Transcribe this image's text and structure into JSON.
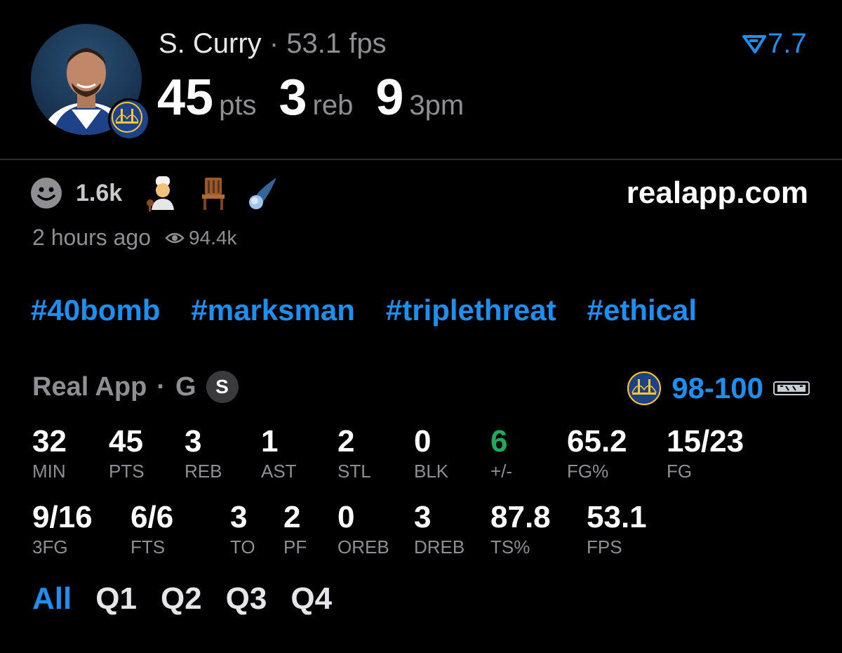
{
  "header": {
    "player_name": "S. Curry",
    "separator": "·",
    "fps_text": "53.1 fps",
    "rating": "7.7",
    "headline": [
      {
        "value": "45",
        "unit": "pts"
      },
      {
        "value": "3",
        "unit": "reb"
      },
      {
        "value": "9",
        "unit": "3pm"
      }
    ]
  },
  "reactions": {
    "count": "1.6k",
    "emojis": [
      "chef-emoji",
      "chair-emoji",
      "comet-emoji"
    ]
  },
  "site": "realapp.com",
  "meta": {
    "time": "2 hours ago",
    "views": "94.4k"
  },
  "tags": [
    "#40bomb",
    "#marksman",
    "#triplethreat",
    "#ethical"
  ],
  "game": {
    "source": "Real App",
    "separator": "·",
    "position": "G",
    "badge": "S",
    "score": "98-100"
  },
  "stats_row1": [
    {
      "value": "32",
      "label": "MIN"
    },
    {
      "value": "45",
      "label": "PTS"
    },
    {
      "value": "3",
      "label": "REB"
    },
    {
      "value": "1",
      "label": "AST"
    },
    {
      "value": "2",
      "label": "STL"
    },
    {
      "value": "0",
      "label": "BLK"
    },
    {
      "value": "6",
      "label": "+/-"
    },
    {
      "value": "65.2",
      "label": "FG%"
    },
    {
      "value": "15/23",
      "label": "FG"
    }
  ],
  "stats_row2": [
    {
      "value": "9/16",
      "label": "3FG"
    },
    {
      "value": "6/6",
      "label": "FTS"
    },
    {
      "value": "3",
      "label": "TO"
    },
    {
      "value": "2",
      "label": "PF"
    },
    {
      "value": "0",
      "label": "OREB"
    },
    {
      "value": "3",
      "label": "DREB"
    },
    {
      "value": "87.8",
      "label": "TS%"
    },
    {
      "value": "53.1",
      "label": "FPS"
    }
  ],
  "tabs": [
    "All",
    "Q1",
    "Q2",
    "Q3",
    "Q4"
  ],
  "active_tab": "All",
  "colors": {
    "accent": "#1d8ff0",
    "positive": "#1faa59",
    "muted": "#8e8e93",
    "warriors": "#1d428a",
    "warriors_gold": "#ffc72c"
  }
}
